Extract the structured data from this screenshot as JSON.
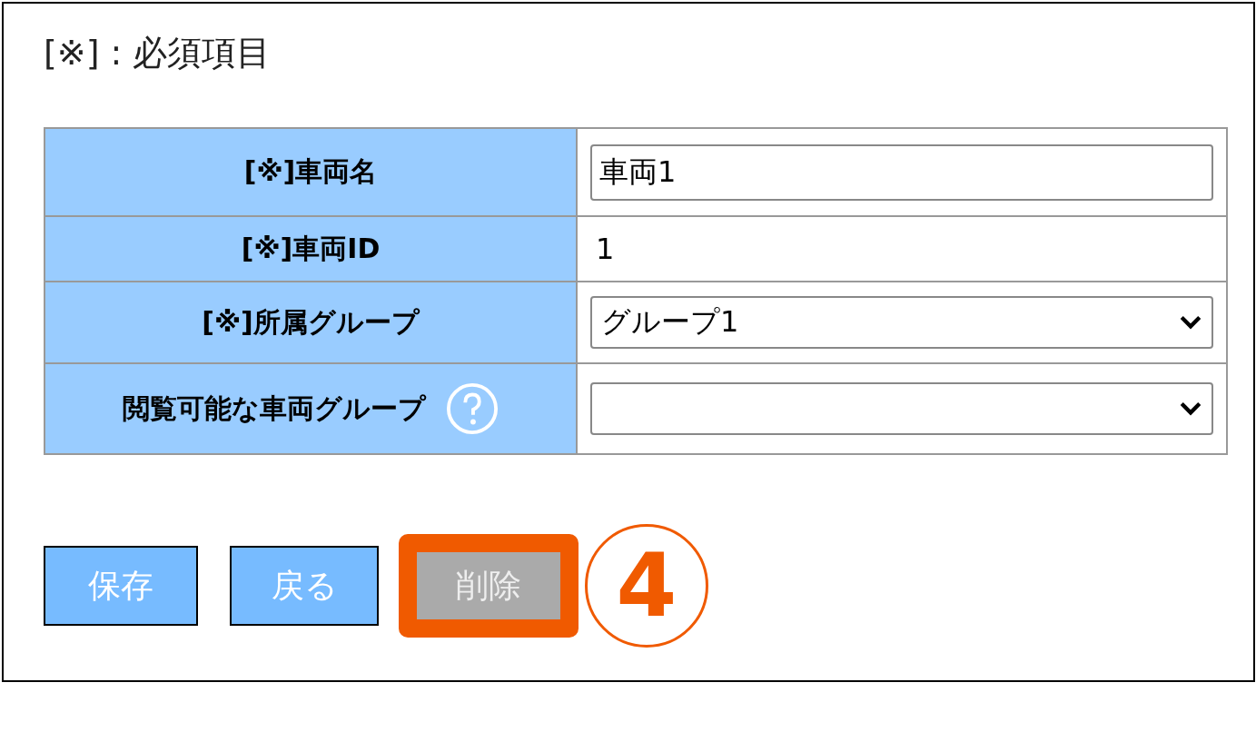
{
  "legend": "[※] : 必須項目",
  "rows": [
    {
      "label": "[※]車両名",
      "kind": "text",
      "value": "車両1"
    },
    {
      "label": "[※]車両ID",
      "kind": "static",
      "value": "1"
    },
    {
      "label": "[※]所属グループ",
      "kind": "select",
      "value": "グループ1"
    },
    {
      "label": "閲覧可能な車両グループ",
      "kind": "select",
      "help": true
    }
  ],
  "buttons": [
    {
      "label": "保存",
      "disabled": false,
      "highlighted": false
    },
    {
      "label": "戻る",
      "disabled": false,
      "highlighted": false
    },
    {
      "label": "削除",
      "disabled": true,
      "highlighted": true
    }
  ],
  "callout": {
    "number": "4"
  }
}
